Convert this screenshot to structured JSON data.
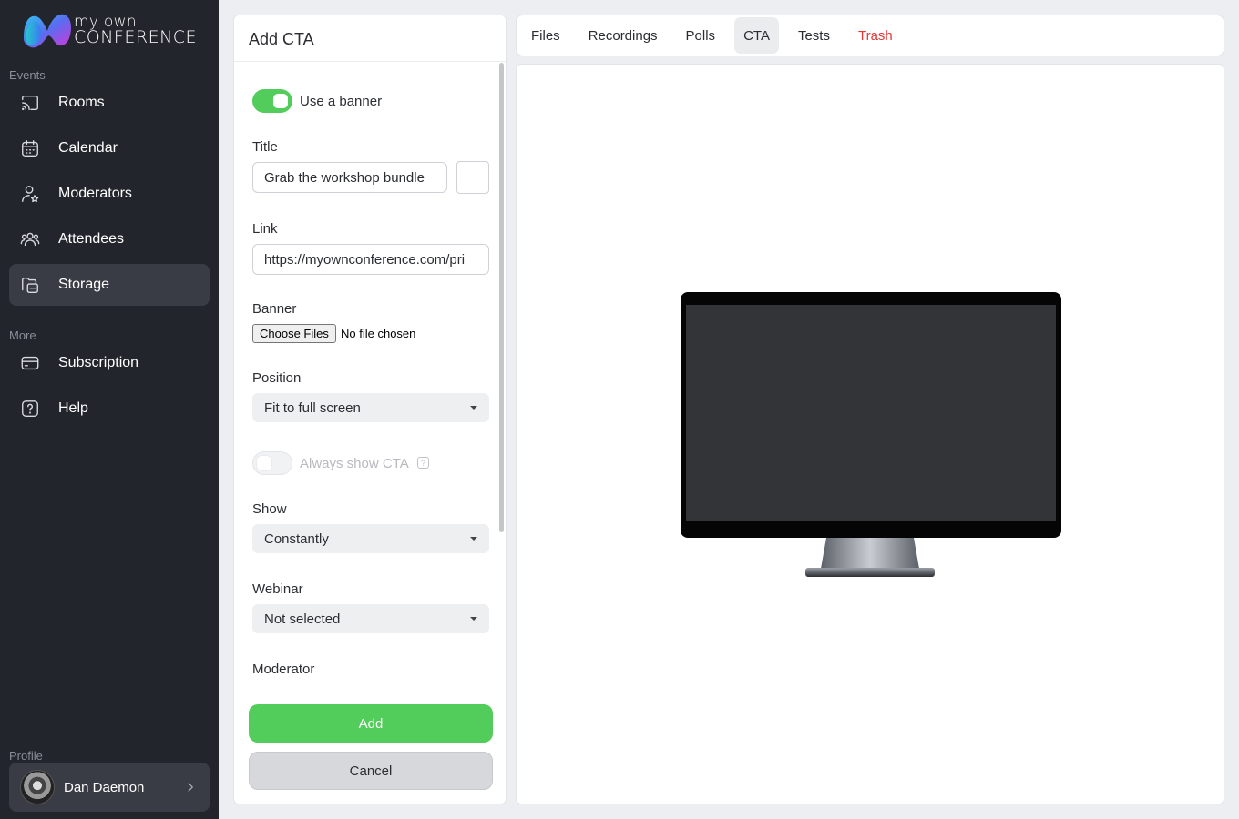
{
  "brand": {
    "line1": "my own",
    "line2": "CONFERENCE"
  },
  "sidebar": {
    "events_label": "Events",
    "more_label": "More",
    "profile_label": "Profile",
    "items": [
      {
        "label": "Rooms",
        "icon": "cast-icon"
      },
      {
        "label": "Calendar",
        "icon": "calendar-icon"
      },
      {
        "label": "Moderators",
        "icon": "moderator-icon"
      },
      {
        "label": "Attendees",
        "icon": "attendees-icon"
      },
      {
        "label": "Storage",
        "icon": "folder-icon",
        "active": true
      },
      {
        "label": "Subscription",
        "icon": "card-icon"
      },
      {
        "label": "Help",
        "icon": "help-icon"
      }
    ],
    "profile": {
      "name": "Dan Daemon"
    }
  },
  "form": {
    "title": "Add CTA",
    "use_banner": {
      "label": "Use a banner",
      "on": true
    },
    "title_field": {
      "label": "Title",
      "value": "Grab the workshop bundle"
    },
    "link_field": {
      "label": "Link",
      "value": "https://myownconference.com/pri"
    },
    "banner": {
      "label": "Banner",
      "button": "Choose Files",
      "status": "No file chosen"
    },
    "position": {
      "label": "Position",
      "value": "Fit to full screen"
    },
    "always_show": {
      "label": "Always show CTA",
      "on": false,
      "help": "?"
    },
    "show": {
      "label": "Show",
      "value": "Constantly"
    },
    "webinar": {
      "label": "Webinar",
      "value": "Not selected"
    },
    "moderator": {
      "label": "Moderator"
    },
    "add_button": "Add",
    "cancel_button": "Cancel"
  },
  "tabs": [
    {
      "label": "Files"
    },
    {
      "label": "Recordings"
    },
    {
      "label": "Polls"
    },
    {
      "label": "CTA",
      "active": true
    },
    {
      "label": "Tests"
    },
    {
      "label": "Trash",
      "danger": true
    }
  ],
  "colors": {
    "accent": "#52cc5a",
    "danger": "#e53935",
    "sidebar_bg": "#23252d",
    "active_item": "#3a3c45"
  }
}
